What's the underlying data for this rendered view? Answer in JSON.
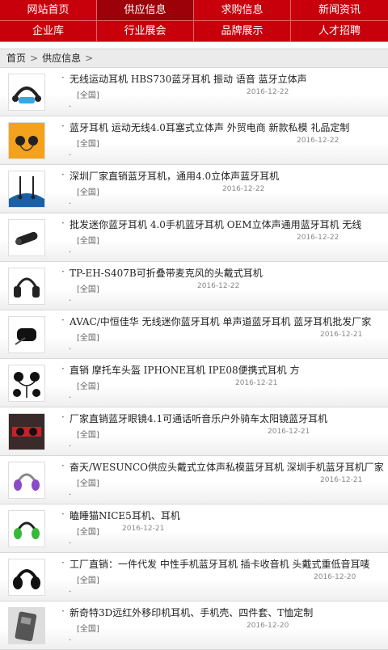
{
  "nav": [
    {
      "label": "网站首页",
      "active": false
    },
    {
      "label": "供应信息",
      "active": true
    },
    {
      "label": "求购信息",
      "active": false
    },
    {
      "label": "新闻资讯",
      "active": false
    },
    {
      "label": "企业库",
      "active": false
    },
    {
      "label": "行业展会",
      "active": false
    },
    {
      "label": "品牌展示",
      "active": false
    },
    {
      "label": "人才招聘",
      "active": false
    }
  ],
  "breadcrumb": {
    "home": "首页",
    "current": "供应信息"
  },
  "items": [
    {
      "title": "无线运动耳机 HBS730蓝牙耳机 振动 语音 蓝牙立体声",
      "region": "[全国]",
      "date": "2016-12-22",
      "thumb": "sport-headset-icon"
    },
    {
      "title": "蓝牙耳机 运动无线4.0耳塞式立体声 外贸电商 新款私模 礼品定制",
      "region": "[全国]",
      "date": "2016-12-22",
      "thumb": "earbuds-orange-icon"
    },
    {
      "title": "深圳厂家直销蓝牙耳机，通用4.0立体声蓝牙耳机",
      "region": "[全国]",
      "date": "2016-12-22",
      "thumb": "neckband-earphone-icon"
    },
    {
      "title": "批发迷你蓝牙耳机 4.0手机蓝牙耳机 OEM立体声通用蓝牙耳机 无线",
      "region": "[全国]",
      "date": "2016-12-22",
      "thumb": "mono-headset-icon"
    },
    {
      "title": "TP-EH-S407B可折叠带麦克风的头戴式耳机",
      "region": "[全国]",
      "date": "2016-12-22",
      "thumb": "headphones-icon"
    },
    {
      "title": "AVAC/中恒佳华 无线迷你蓝牙耳机 单声道蓝牙耳机 蓝牙耳机批发厂家",
      "region": "[全国]",
      "date": "2016-12-21",
      "thumb": "mini-headset-icon"
    },
    {
      "title": "直销 摩托车头盔 IPHONE耳机 IPE08便携式耳机 方",
      "region": "[全国]",
      "date": "2016-12-21",
      "thumb": "helmet-earphone-icon"
    },
    {
      "title": "厂家直销蓝牙眼镜4.1可通话听音乐户外骑车太阳镜蓝牙耳机",
      "region": "[全国]",
      "date": "2016-12-21",
      "thumb": "bluetooth-glasses-icon"
    },
    {
      "title": "奋天/WESUNCO供应头戴式立体声私模蓝牙耳机 深圳手机蓝牙耳机厂家",
      "region": "[全国]",
      "date": "2016-12-21",
      "thumb": "purple-headphones-icon"
    },
    {
      "title": "瞌睡猫NICE5耳机、耳机",
      "region": "[全国]",
      "date": "2016-12-21",
      "thumb": "green-headphones-icon"
    },
    {
      "title": "工厂直销：一件代发 中性手机蓝牙耳机 插卡收音机 头戴式重低音耳唛",
      "region": "[全国]",
      "date": "2016-12-20",
      "thumb": "black-headphones-icon"
    },
    {
      "title": "新奇特3D远红外移印机耳机、手机壳、四件套、T恤定制",
      "region": "[全国]",
      "date": "2016-12-20",
      "thumb": "printer-machine-icon"
    }
  ],
  "colors": {
    "nav_bg": "#c8000b",
    "nav_active": "#9c0008"
  }
}
